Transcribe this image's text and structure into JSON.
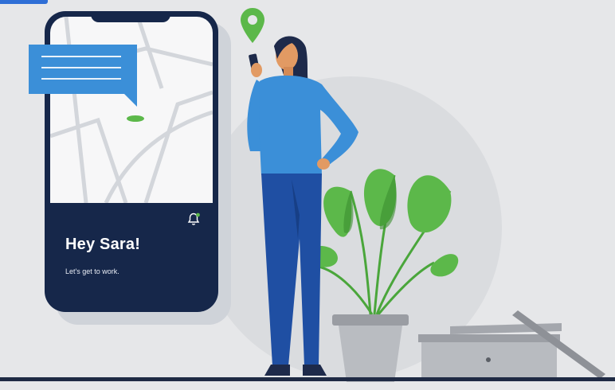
{
  "phone": {
    "greeting": "Hey Sara!",
    "subline": "Let's get to work."
  },
  "icons": {
    "bell": "bell-icon",
    "location": "location-pin-icon",
    "chat": "chat-bubble-icon"
  },
  "colors": {
    "background": "#e6e7e9",
    "phone_body": "#16274a",
    "accent_blue": "#3b8fd8",
    "accent_green": "#5cb84a",
    "shirt": "#3b8fd8",
    "pants": "#1f4fa3"
  }
}
